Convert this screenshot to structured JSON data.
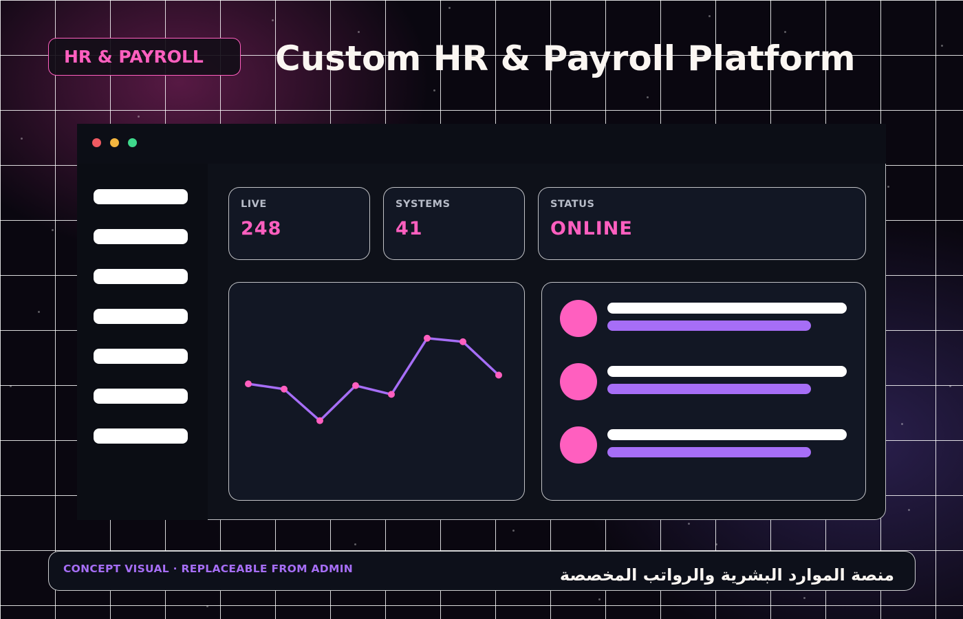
{
  "badge": {
    "label": "HR & PAYROLL"
  },
  "headline": "Custom HR & Payroll Platform",
  "window": {
    "controls": [
      "close",
      "minimize",
      "maximize"
    ],
    "sidebar": {
      "item_count": 7
    },
    "stats": [
      {
        "label": "LIVE",
        "value": "248"
      },
      {
        "label": "SYSTEMS",
        "value": "41"
      },
      {
        "label": "STATUS",
        "value": "ONLINE"
      }
    ],
    "list": {
      "row_count": 3
    }
  },
  "chart_data": {
    "type": "line",
    "x": [
      1,
      2,
      3,
      4,
      5,
      6,
      7,
      8
    ],
    "series": [
      {
        "values": [
          58,
          55,
          37,
          57,
          52,
          84,
          82,
          63
        ]
      }
    ],
    "ylim": [
      0,
      100
    ],
    "grid": false,
    "colors": {
      "line": "#a66ef6",
      "point": "#ff5fbf"
    }
  },
  "footer": {
    "left": "CONCEPT VISUAL · REPLACEABLE FROM ADMIN",
    "right": "منصة الموارد البشرية والرواتب المخصصة"
  },
  "colors": {
    "accent_pink": "#ff5fbf",
    "accent_purple": "#a66ef6",
    "panel_bg": "#121724",
    "window_bg": "#0e1119"
  }
}
